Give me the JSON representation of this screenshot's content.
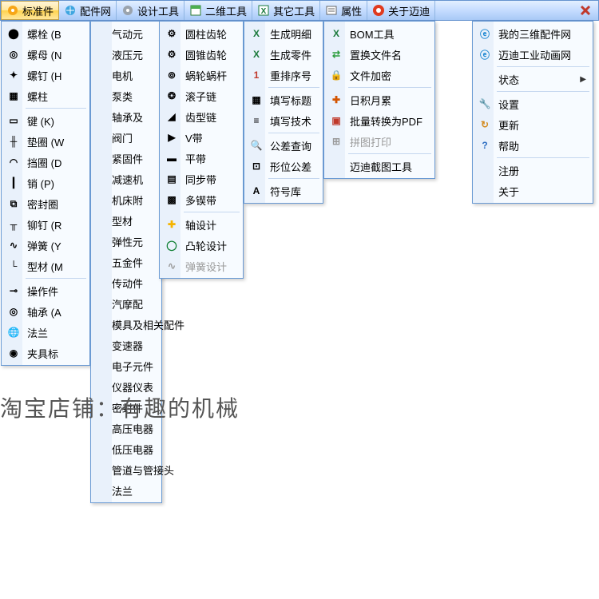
{
  "menubar": {
    "items": [
      {
        "label": "标准件"
      },
      {
        "label": "配件网"
      },
      {
        "label": "设计工具"
      },
      {
        "label": "二维工具"
      },
      {
        "label": "其它工具"
      },
      {
        "label": "属性"
      },
      {
        "label": "关于迈迪"
      }
    ]
  },
  "menu_std": {
    "items": [
      {
        "label": "螺栓 (B"
      },
      {
        "label": "螺母 (N"
      },
      {
        "label": "螺钉 (H"
      },
      {
        "label": "螺柱"
      },
      {
        "label": "键 (K)"
      },
      {
        "label": "垫圈 (W"
      },
      {
        "label": "挡圈 (D"
      },
      {
        "label": "销 (P)"
      },
      {
        "label": "密封圈"
      },
      {
        "label": "铆钉 (R"
      },
      {
        "label": "弹簧 (Y"
      },
      {
        "label": "型材 (M"
      },
      {
        "label": "操作件"
      },
      {
        "label": "轴承 (A"
      },
      {
        "label": "法兰"
      },
      {
        "label": "夹具标"
      }
    ]
  },
  "menu_parts": {
    "items": [
      {
        "label": "气动元"
      },
      {
        "label": "液压元"
      },
      {
        "label": "电机"
      },
      {
        "label": "泵类"
      },
      {
        "label": "轴承及"
      },
      {
        "label": "阀门"
      },
      {
        "label": "紧固件"
      },
      {
        "label": "减速机"
      },
      {
        "label": "机床附"
      },
      {
        "label": "型材"
      },
      {
        "label": "弹性元"
      },
      {
        "label": "五金件"
      },
      {
        "label": "传动件"
      },
      {
        "label": "汽摩配"
      },
      {
        "label": "模具及相关配件"
      },
      {
        "label": "变速器"
      },
      {
        "label": "电子元件"
      },
      {
        "label": "仪器仪表"
      },
      {
        "label": "密封件"
      },
      {
        "label": "高压电器"
      },
      {
        "label": "低压电器"
      },
      {
        "label": "管道与管接头"
      },
      {
        "label": "法兰"
      }
    ]
  },
  "menu_design": {
    "items": [
      {
        "label": "圆柱齿轮"
      },
      {
        "label": "圆锥齿轮"
      },
      {
        "label": "蜗轮蜗杆"
      },
      {
        "label": "滚子链"
      },
      {
        "label": "齿型链"
      },
      {
        "label": "V带"
      },
      {
        "label": "平带"
      },
      {
        "label": "同步带"
      },
      {
        "label": "多锲带"
      },
      {
        "label": "轴设计"
      },
      {
        "label": "凸轮设计"
      },
      {
        "label": "弹簧设计"
      }
    ]
  },
  "menu_2d": {
    "items": [
      {
        "label": "生成明细"
      },
      {
        "label": "生成零件"
      },
      {
        "label": "重排序号"
      },
      {
        "label": "填写标题"
      },
      {
        "label": "填写技术"
      },
      {
        "label": "公差查询"
      },
      {
        "label": "形位公差"
      },
      {
        "label": "符号库"
      }
    ]
  },
  "menu_other": {
    "items": [
      {
        "label": "BOM工具"
      },
      {
        "label": "置换文件名"
      },
      {
        "label": "文件加密"
      },
      {
        "label": "日积月累"
      },
      {
        "label": "批量转换为PDF"
      },
      {
        "label": "拼图打印"
      },
      {
        "label": "迈迪截图工具"
      }
    ]
  },
  "menu_about": {
    "items": [
      {
        "label": "我的三维配件网"
      },
      {
        "label": "迈迪工业动画网"
      },
      {
        "label": "状态"
      },
      {
        "label": "设置"
      },
      {
        "label": "更新"
      },
      {
        "label": "帮助"
      },
      {
        "label": "注册"
      },
      {
        "label": "关于"
      }
    ]
  },
  "watermark": "淘宝店铺：有趣的机械"
}
